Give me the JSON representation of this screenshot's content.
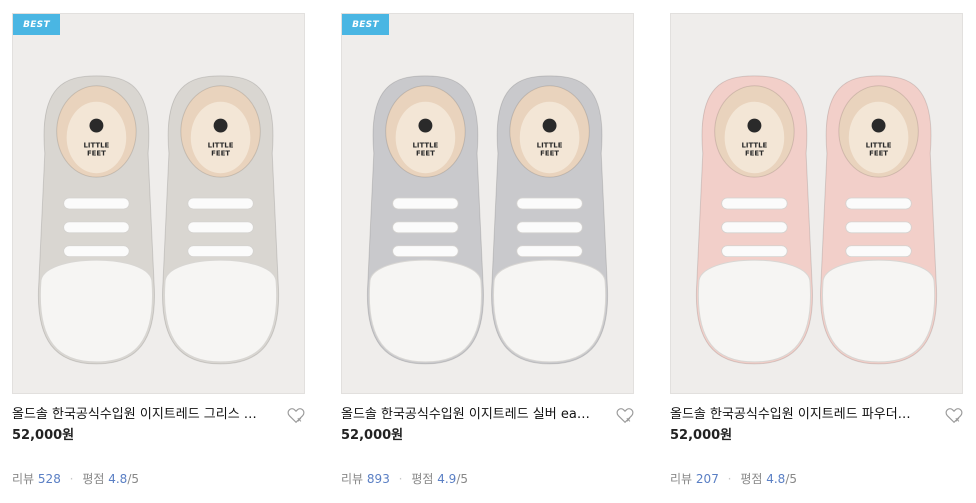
{
  "products": [
    {
      "badge": "BEST",
      "title": "올드솔 한국공식수입원 이지트레드 그리스 …",
      "price": "52,000원",
      "review_label": "리뷰",
      "review_count": "528",
      "rating_label": "평점",
      "rating": "4.8",
      "rating_max": "/5",
      "shoe_color": "#d9d6d1",
      "image_text": "LITTLE FEET"
    },
    {
      "badge": "BEST",
      "title": "올드솔 한국공식수입원 이지트레드 실버 ea…",
      "price": "52,000원",
      "review_label": "리뷰",
      "review_count": "893",
      "rating_label": "평점",
      "rating": "4.9",
      "rating_max": "/5",
      "shoe_color": "#c9c9cc",
      "image_text": "LITTLE FEET"
    },
    {
      "badge": "",
      "title": "올드솔 한국공식수입원 이지트레드 파우더…",
      "price": "52,000원",
      "review_label": "리뷰",
      "review_count": "207",
      "rating_label": "평점",
      "rating": "4.8",
      "rating_max": "/5",
      "shoe_color": "#f2cfc9",
      "image_text": "LITTLE FEET"
    }
  ],
  "colors": {
    "badge": "#4ab6e3",
    "link_number": "#5a7fc4"
  },
  "icons": {
    "wishlist": "heart-outline-icon"
  }
}
